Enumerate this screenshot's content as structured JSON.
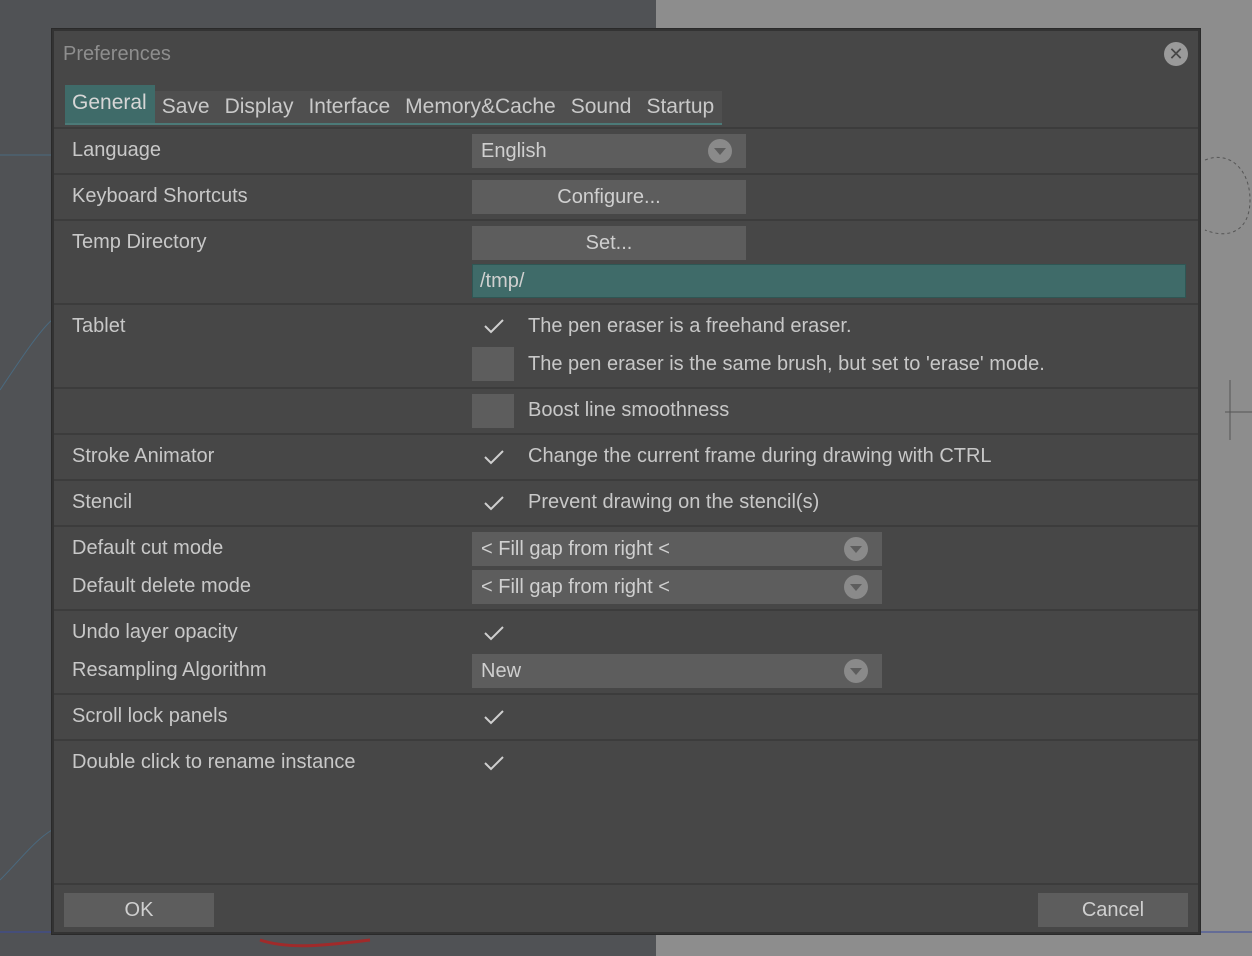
{
  "dialog": {
    "title": "Preferences",
    "close_label": "✕"
  },
  "tabs": [
    {
      "label": "General",
      "active": true
    },
    {
      "label": "Save",
      "active": false
    },
    {
      "label": "Display",
      "active": false
    },
    {
      "label": "Interface",
      "active": false
    },
    {
      "label": "Memory&Cache",
      "active": false
    },
    {
      "label": "Sound",
      "active": false
    },
    {
      "label": "Startup",
      "active": false
    }
  ],
  "settings": {
    "language": {
      "label": "Language",
      "value": "English"
    },
    "keyboard_shortcuts": {
      "label": "Keyboard Shortcuts",
      "button": "Configure..."
    },
    "temp_directory": {
      "label": "Temp Directory",
      "button": "Set...",
      "path": "/tmp/"
    },
    "tablet": {
      "label": "Tablet",
      "option_freehand": {
        "text": "The pen eraser is a freehand eraser.",
        "checked": true
      },
      "option_same_brush": {
        "text": "The pen eraser is the same brush, but set to 'erase' mode.",
        "checked": false
      },
      "option_boost": {
        "text": "Boost line smoothness",
        "checked": false
      }
    },
    "stroke_animator": {
      "label": "Stroke Animator",
      "text": "Change the current frame during drawing with CTRL",
      "checked": true
    },
    "stencil": {
      "label": "Stencil",
      "text": "Prevent drawing on the stencil(s)",
      "checked": true
    },
    "default_cut_mode": {
      "label": "Default cut mode",
      "value": "< Fill gap from right <"
    },
    "default_delete_mode": {
      "label": "Default delete mode",
      "value": "< Fill gap from right <"
    },
    "undo_layer_opacity": {
      "label": "Undo layer opacity",
      "checked": true
    },
    "resampling_algorithm": {
      "label": "Resampling Algorithm",
      "value": "New"
    },
    "scroll_lock_panels": {
      "label": "Scroll lock panels",
      "checked": true
    },
    "double_click_rename": {
      "label": "Double click to rename instance",
      "checked": true
    }
  },
  "footer": {
    "ok_label": "OK",
    "cancel_label": "Cancel"
  },
  "colors": {
    "accent": "#3f6b69",
    "dialog_bg": "#474747",
    "field_bg": "#5d5d5d"
  }
}
